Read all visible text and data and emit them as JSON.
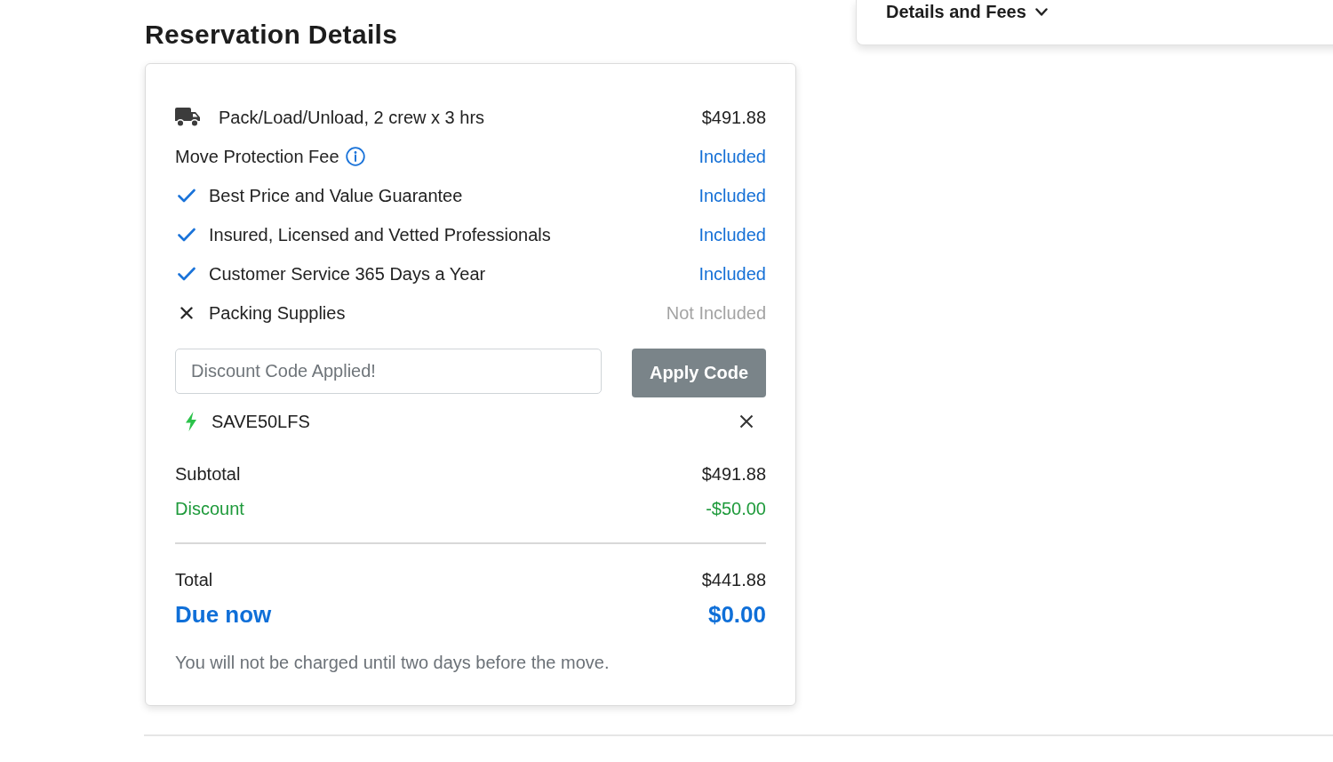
{
  "details_panel": {
    "title": "Details and Fees"
  },
  "reservation": {
    "title": "Reservation Details",
    "line_items": [
      {
        "kind": "service",
        "label": "Pack/Load/Unload, 2 crew x 3 hrs",
        "value": "$491.88"
      },
      {
        "kind": "fee",
        "label": "Move Protection Fee",
        "value": "Included",
        "included": true
      },
      {
        "kind": "feature",
        "label": "Best Price and Value Guarantee",
        "value": "Included",
        "included": true
      },
      {
        "kind": "feature",
        "label": "Insured, Licensed and Vetted Professionals",
        "value": "Included",
        "included": true
      },
      {
        "kind": "feature",
        "label": "Customer Service 365 Days a Year",
        "value": "Included",
        "included": true
      },
      {
        "kind": "feature",
        "label": "Packing Supplies",
        "value": "Not Included",
        "included": false
      }
    ],
    "discount": {
      "placeholder": "Discount Code Applied!",
      "button": "Apply Code",
      "applied_code": "SAVE50LFS"
    },
    "summary": [
      {
        "kind": "subtotal",
        "label": "Subtotal",
        "value": "$491.88"
      },
      {
        "kind": "discount",
        "label": "Discount",
        "value": "-$50.00"
      }
    ],
    "total": {
      "label": "Total",
      "value": "$441.88"
    },
    "due_now": {
      "label": "Due now",
      "value": "$0.00"
    },
    "note": "You will not be charged until two days before the move."
  }
}
